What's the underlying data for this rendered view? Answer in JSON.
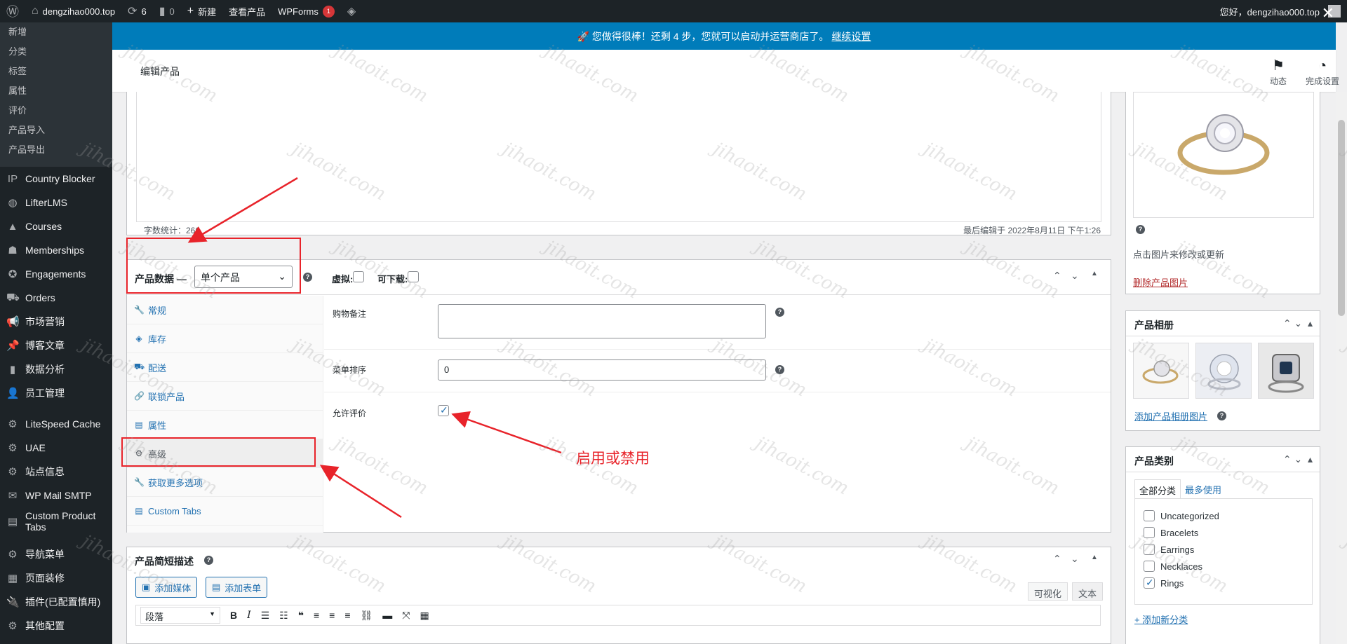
{
  "adminbar": {
    "site": "dengzihao000.top",
    "updates": "6",
    "comments": "0",
    "new": "新建",
    "view_product": "查看产品",
    "wpforms": "WPForms",
    "wpforms_badge": "1",
    "greeting": "您好，dengzihao000.top"
  },
  "sidebar": {
    "submenu": [
      "新增",
      "分类",
      "标签",
      "属性",
      "评价",
      "产品导入",
      "产品导出"
    ],
    "items": [
      {
        "label": "Country Blocker",
        "icon": "IP"
      },
      {
        "label": "LifterLMS",
        "icon": "◍"
      },
      {
        "label": "Courses",
        "icon": "▲"
      },
      {
        "label": "Memberships",
        "icon": "☗"
      },
      {
        "label": "Engagements",
        "icon": "✪"
      },
      {
        "label": "Orders",
        "icon": "⛟"
      },
      {
        "label": "市场营销",
        "icon": "📢"
      },
      {
        "label": "博客文章",
        "icon": "📌"
      },
      {
        "label": "数据分析",
        "icon": "▮"
      },
      {
        "label": "员工管理",
        "icon": "👤"
      },
      {
        "label": "LiteSpeed Cache",
        "icon": "⚙"
      },
      {
        "label": "UAE",
        "icon": "⚙"
      },
      {
        "label": "站点信息",
        "icon": "⚙"
      },
      {
        "label": "WP Mail SMTP",
        "icon": "✉"
      },
      {
        "label": "Custom Product Tabs",
        "icon": "▤"
      },
      {
        "label": "导航菜单",
        "icon": "⚙"
      },
      {
        "label": "页面装修",
        "icon": "▦"
      },
      {
        "label": "插件(已配置慎用)",
        "icon": "🔌"
      },
      {
        "label": "其他配置",
        "icon": "⚙"
      }
    ]
  },
  "notice": {
    "text": "🚀 您做得很棒！还剩 4 步，您就可以启动并运营商店了。",
    "link": "继续设置"
  },
  "header": {
    "title": "编辑产品",
    "activity": "动态",
    "finish_setup": "完成设置"
  },
  "editor": {
    "word_count": "字数统计：266",
    "last_edit": "最后编辑于 2022年8月11日 下午1:26"
  },
  "product_data": {
    "label": "产品数据 —",
    "type": "单个产品",
    "virtual": "虚拟:",
    "downloadable": "可下载:",
    "tabs": [
      {
        "label": "常规",
        "icon": "🔧"
      },
      {
        "label": "库存",
        "icon": "◈"
      },
      {
        "label": "配送",
        "icon": "⛟"
      },
      {
        "label": "联锁产品",
        "icon": "🔗"
      },
      {
        "label": "属性",
        "icon": "▤"
      },
      {
        "label": "高级",
        "icon": "⚙"
      },
      {
        "label": "获取更多选项",
        "icon": "🔧"
      },
      {
        "label": "Custom Tabs",
        "icon": "▤"
      }
    ],
    "purchase_note_label": "购物备注",
    "menu_order_label": "菜单排序",
    "menu_order_value": "0",
    "reviews_label": "允许评价"
  },
  "annotation": {
    "text": "启用或禁用"
  },
  "short_desc": {
    "title": "产品简短描述",
    "add_media": "添加媒体",
    "add_form": "添加表单",
    "visual": "可视化",
    "text": "文本",
    "format": "段落"
  },
  "product_image": {
    "hint": "点击图片来修改或更新",
    "remove": "删除产品图片"
  },
  "gallery": {
    "title": "产品相册",
    "add": "添加产品相册图片"
  },
  "categories": {
    "title": "产品类别",
    "tab_all": "全部分类",
    "tab_popular": "最多使用",
    "items": [
      {
        "label": "Uncategorized",
        "checked": false
      },
      {
        "label": "Bracelets",
        "checked": false
      },
      {
        "label": "Earrings",
        "checked": false
      },
      {
        "label": "Necklaces",
        "checked": false
      },
      {
        "label": "Rings",
        "checked": true
      }
    ],
    "add": "+ 添加新分类"
  },
  "watermark": "jihaoit.com"
}
